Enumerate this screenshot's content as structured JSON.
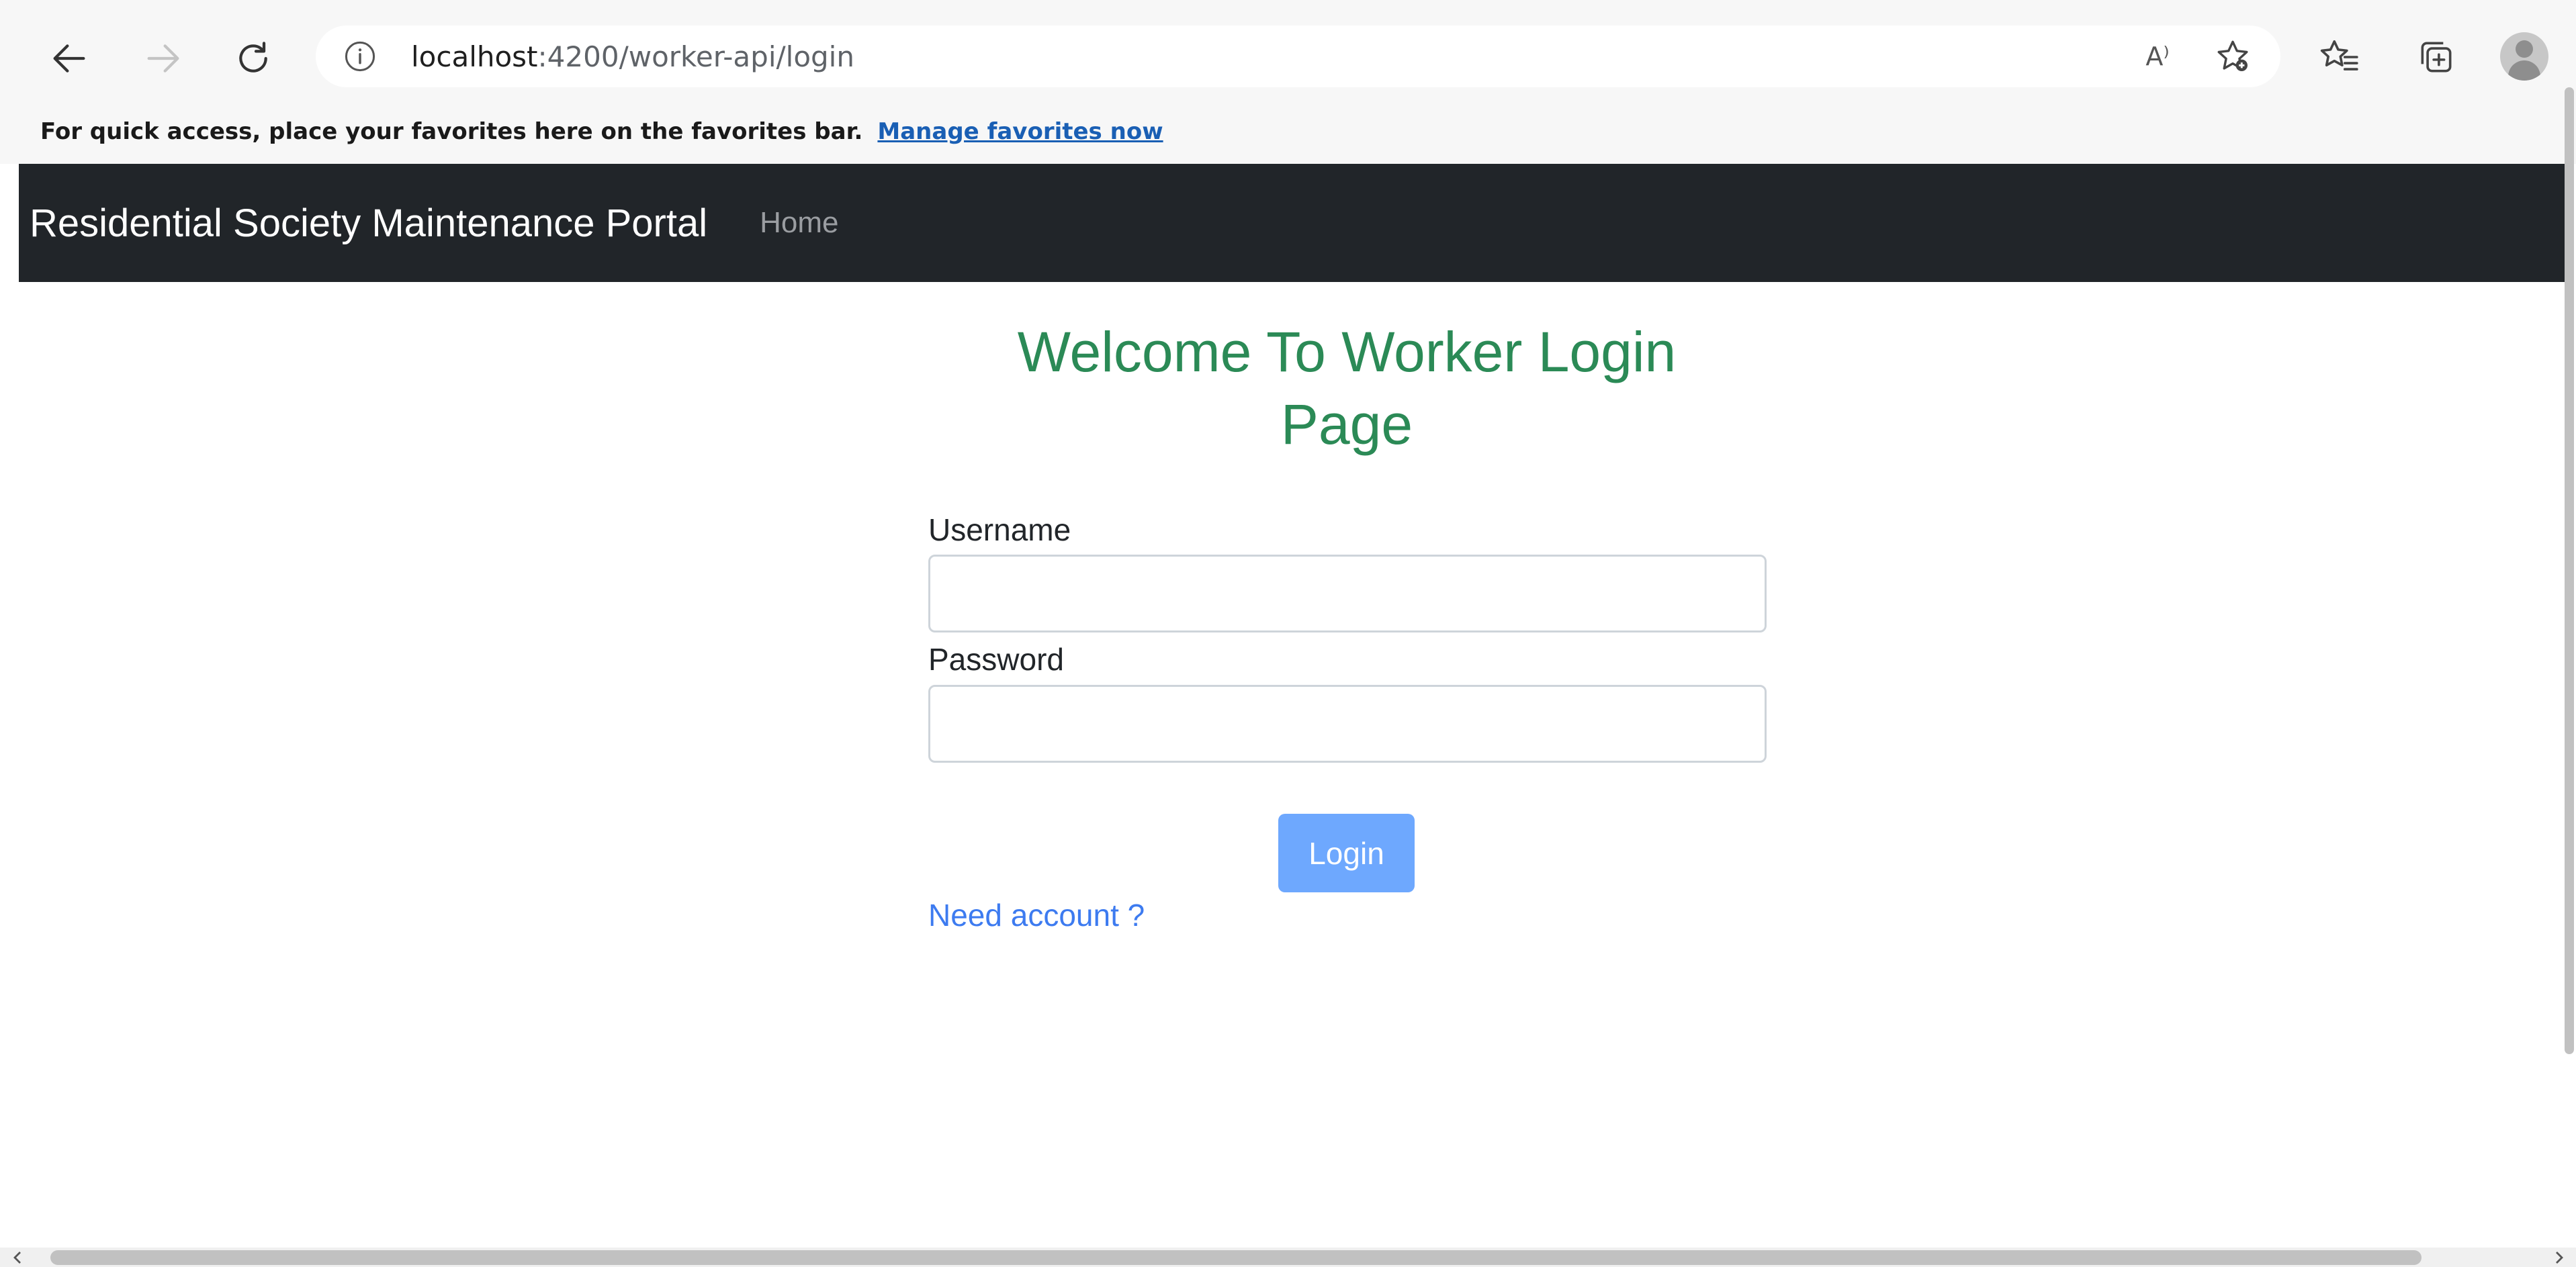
{
  "browser": {
    "url_host": "localhost",
    "url_path": ":4200/worker-api/login",
    "favorites_message": "For quick access, place your favorites here on the favorites bar.",
    "favorites_link": "Manage favorites now",
    "read_aloud_label": "A⁾"
  },
  "navbar": {
    "brand": "Residential Society Maintenance Portal",
    "home_link": "Home"
  },
  "login_form": {
    "title_line1": "Welcome To Worker Login",
    "title_line2": "Page",
    "username_label": "Username",
    "username_value": "",
    "password_label": "Password",
    "password_value": "",
    "login_button": "Login",
    "need_account_link": "Need account ?"
  },
  "colors": {
    "navbar_bg": "#212529",
    "title_green": "#2b8a56",
    "login_button_bg": "#6ea8fe",
    "link_blue": "#3d7bf0"
  }
}
